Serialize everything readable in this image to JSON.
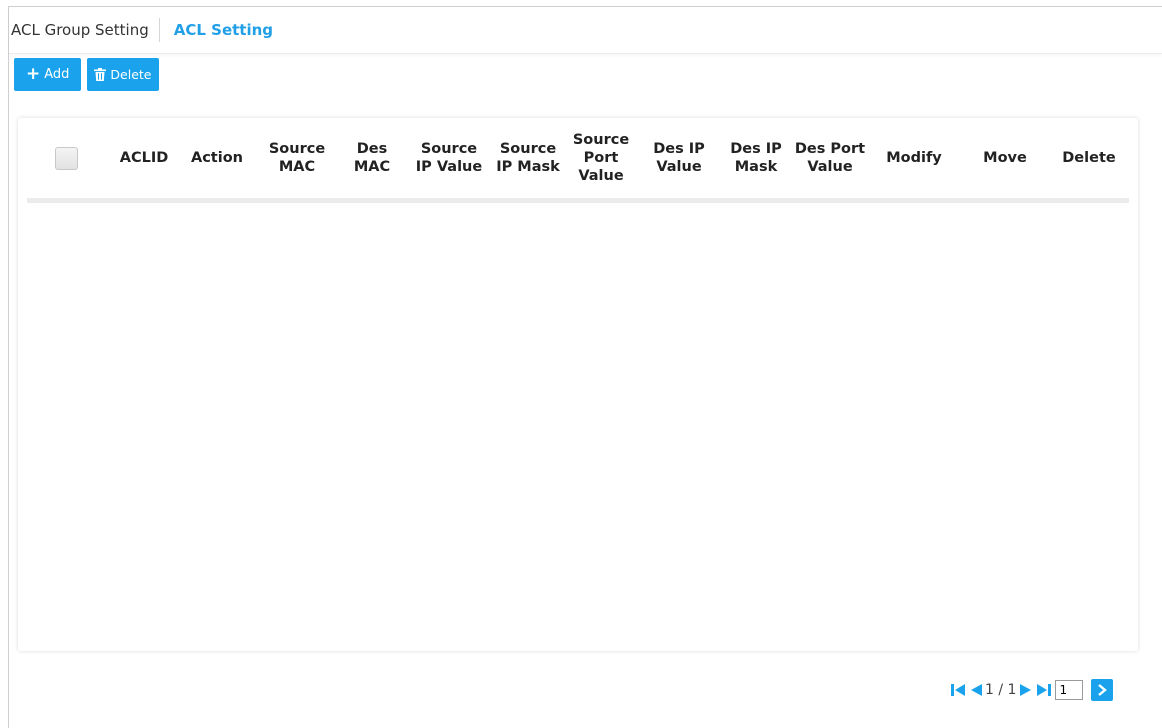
{
  "tabs": {
    "group_label": "ACL Group Setting",
    "setting_label": "ACL Setting"
  },
  "toolbar": {
    "add_label": "Add",
    "delete_label": "Delete"
  },
  "table": {
    "columns": {
      "aclid": "ACLID",
      "action": "Action",
      "source_mac": [
        "Source",
        "MAC"
      ],
      "des_mac": [
        "Des",
        "MAC"
      ],
      "source_ip_value": [
        "Source",
        "IP Value"
      ],
      "source_ip_mask": [
        "Source",
        "IP Mask"
      ],
      "source_port_value": [
        "Source",
        "Port",
        "Value"
      ],
      "des_ip_value": [
        "Des IP",
        "Value"
      ],
      "des_ip_mask": [
        "Des IP",
        "Mask"
      ],
      "des_port_value": [
        "Des Port",
        "Value"
      ],
      "modify": "Modify",
      "move": "Move",
      "delete": "Delete"
    },
    "rows": []
  },
  "pagination": {
    "page_text": "1 / 1",
    "page_input_value": "1"
  },
  "colors": {
    "accent": "#1aa3ec",
    "active_tab": "#21a0e8"
  }
}
